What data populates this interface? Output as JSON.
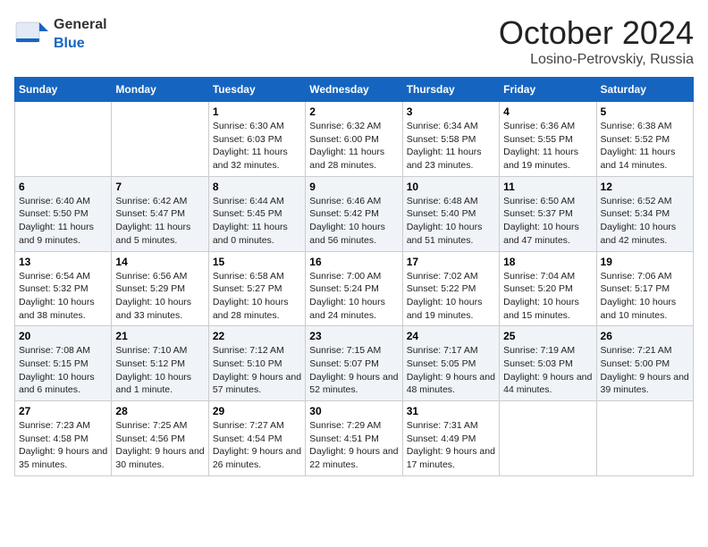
{
  "logo": {
    "text_general": "General",
    "text_blue": "Blue"
  },
  "title": {
    "month_year": "October 2024",
    "location": "Losino-Petrovskiy, Russia"
  },
  "weekdays": [
    "Sunday",
    "Monday",
    "Tuesday",
    "Wednesday",
    "Thursday",
    "Friday",
    "Saturday"
  ],
  "weeks": [
    [
      {
        "day": "",
        "content": ""
      },
      {
        "day": "",
        "content": ""
      },
      {
        "day": "1",
        "content": "Sunrise: 6:30 AM\nSunset: 6:03 PM\nDaylight: 11 hours and 32 minutes."
      },
      {
        "day": "2",
        "content": "Sunrise: 6:32 AM\nSunset: 6:00 PM\nDaylight: 11 hours and 28 minutes."
      },
      {
        "day": "3",
        "content": "Sunrise: 6:34 AM\nSunset: 5:58 PM\nDaylight: 11 hours and 23 minutes."
      },
      {
        "day": "4",
        "content": "Sunrise: 6:36 AM\nSunset: 5:55 PM\nDaylight: 11 hours and 19 minutes."
      },
      {
        "day": "5",
        "content": "Sunrise: 6:38 AM\nSunset: 5:52 PM\nDaylight: 11 hours and 14 minutes."
      }
    ],
    [
      {
        "day": "6",
        "content": "Sunrise: 6:40 AM\nSunset: 5:50 PM\nDaylight: 11 hours and 9 minutes."
      },
      {
        "day": "7",
        "content": "Sunrise: 6:42 AM\nSunset: 5:47 PM\nDaylight: 11 hours and 5 minutes."
      },
      {
        "day": "8",
        "content": "Sunrise: 6:44 AM\nSunset: 5:45 PM\nDaylight: 11 hours and 0 minutes."
      },
      {
        "day": "9",
        "content": "Sunrise: 6:46 AM\nSunset: 5:42 PM\nDaylight: 10 hours and 56 minutes."
      },
      {
        "day": "10",
        "content": "Sunrise: 6:48 AM\nSunset: 5:40 PM\nDaylight: 10 hours and 51 minutes."
      },
      {
        "day": "11",
        "content": "Sunrise: 6:50 AM\nSunset: 5:37 PM\nDaylight: 10 hours and 47 minutes."
      },
      {
        "day": "12",
        "content": "Sunrise: 6:52 AM\nSunset: 5:34 PM\nDaylight: 10 hours and 42 minutes."
      }
    ],
    [
      {
        "day": "13",
        "content": "Sunrise: 6:54 AM\nSunset: 5:32 PM\nDaylight: 10 hours and 38 minutes."
      },
      {
        "day": "14",
        "content": "Sunrise: 6:56 AM\nSunset: 5:29 PM\nDaylight: 10 hours and 33 minutes."
      },
      {
        "day": "15",
        "content": "Sunrise: 6:58 AM\nSunset: 5:27 PM\nDaylight: 10 hours and 28 minutes."
      },
      {
        "day": "16",
        "content": "Sunrise: 7:00 AM\nSunset: 5:24 PM\nDaylight: 10 hours and 24 minutes."
      },
      {
        "day": "17",
        "content": "Sunrise: 7:02 AM\nSunset: 5:22 PM\nDaylight: 10 hours and 19 minutes."
      },
      {
        "day": "18",
        "content": "Sunrise: 7:04 AM\nSunset: 5:20 PM\nDaylight: 10 hours and 15 minutes."
      },
      {
        "day": "19",
        "content": "Sunrise: 7:06 AM\nSunset: 5:17 PM\nDaylight: 10 hours and 10 minutes."
      }
    ],
    [
      {
        "day": "20",
        "content": "Sunrise: 7:08 AM\nSunset: 5:15 PM\nDaylight: 10 hours and 6 minutes."
      },
      {
        "day": "21",
        "content": "Sunrise: 7:10 AM\nSunset: 5:12 PM\nDaylight: 10 hours and 1 minute."
      },
      {
        "day": "22",
        "content": "Sunrise: 7:12 AM\nSunset: 5:10 PM\nDaylight: 9 hours and 57 minutes."
      },
      {
        "day": "23",
        "content": "Sunrise: 7:15 AM\nSunset: 5:07 PM\nDaylight: 9 hours and 52 minutes."
      },
      {
        "day": "24",
        "content": "Sunrise: 7:17 AM\nSunset: 5:05 PM\nDaylight: 9 hours and 48 minutes."
      },
      {
        "day": "25",
        "content": "Sunrise: 7:19 AM\nSunset: 5:03 PM\nDaylight: 9 hours and 44 minutes."
      },
      {
        "day": "26",
        "content": "Sunrise: 7:21 AM\nSunset: 5:00 PM\nDaylight: 9 hours and 39 minutes."
      }
    ],
    [
      {
        "day": "27",
        "content": "Sunrise: 7:23 AM\nSunset: 4:58 PM\nDaylight: 9 hours and 35 minutes."
      },
      {
        "day": "28",
        "content": "Sunrise: 7:25 AM\nSunset: 4:56 PM\nDaylight: 9 hours and 30 minutes."
      },
      {
        "day": "29",
        "content": "Sunrise: 7:27 AM\nSunset: 4:54 PM\nDaylight: 9 hours and 26 minutes."
      },
      {
        "day": "30",
        "content": "Sunrise: 7:29 AM\nSunset: 4:51 PM\nDaylight: 9 hours and 22 minutes."
      },
      {
        "day": "31",
        "content": "Sunrise: 7:31 AM\nSunset: 4:49 PM\nDaylight: 9 hours and 17 minutes."
      },
      {
        "day": "",
        "content": ""
      },
      {
        "day": "",
        "content": ""
      }
    ]
  ]
}
